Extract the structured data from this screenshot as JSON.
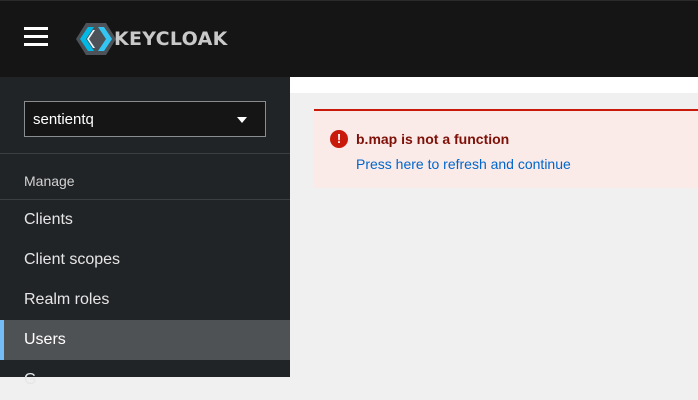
{
  "header": {
    "menu_icon": "hamburger-menu-icon",
    "logo_text": "KEYCLOAK",
    "logo_icon": "keycloak-logo-icon"
  },
  "sidebar": {
    "realm": "sentientq",
    "realm_dropdown_icon": "caret-down-icon",
    "section_title": "Manage",
    "items": [
      {
        "label": "Clients"
      },
      {
        "label": "Client scopes"
      },
      {
        "label": "Realm roles"
      },
      {
        "label": "Users",
        "active": true
      }
    ],
    "partial_item_label": "G"
  },
  "alert": {
    "icon": "exclamation-circle-icon",
    "icon_glyph": "!",
    "title": "b.map is not a function",
    "action": "Press here to refresh and continue"
  },
  "colors": {
    "topbar_bg": "#151515",
    "sidebar_bg": "#212427",
    "active_item_bg": "#4f5255",
    "active_accent": "#73bcf7",
    "danger": "#c9190b",
    "alert_bg": "#faeae8",
    "link": "#0066cc"
  }
}
